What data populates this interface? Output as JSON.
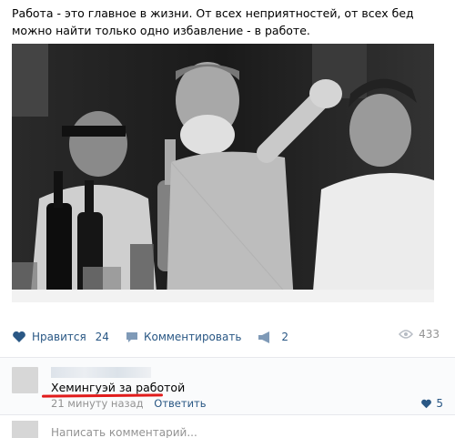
{
  "post": {
    "text": "Работа - это главное в жизни. От всех неприятностей, от всех бед можно найти только одно избавление - в работе."
  },
  "actions": {
    "like_label": "Нравится",
    "like_count": "24",
    "comment_label": "Комментировать",
    "share_count": "2",
    "views_count": "433"
  },
  "comment": {
    "text": "Хемингуэй за работой",
    "time": "21 минуту назад",
    "reply_label": "Ответить",
    "likes": "5"
  },
  "reply_box": {
    "placeholder": "Написать комментарий..."
  },
  "colors": {
    "link": "#2a5885",
    "muted": "#939393",
    "highlight": "#e11b1b"
  }
}
